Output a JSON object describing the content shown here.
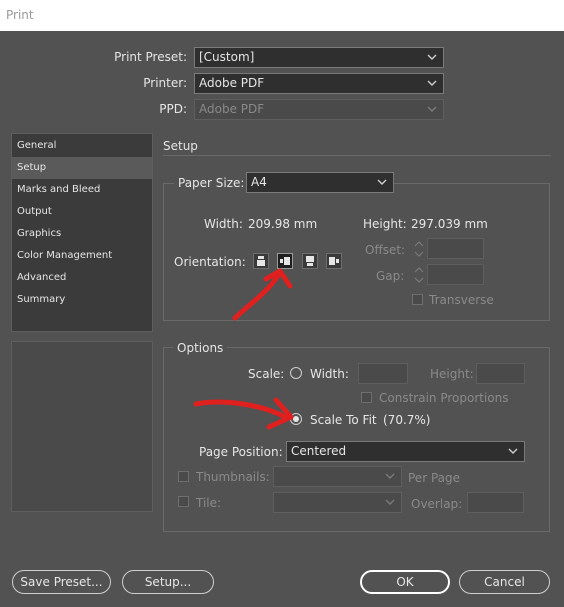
{
  "window": {
    "title": "Print"
  },
  "top": {
    "preset_label": "Print Preset:",
    "preset_value": "[Custom]",
    "printer_label": "Printer:",
    "printer_value": "Adobe PDF",
    "ppd_label": "PPD:",
    "ppd_value": "Adobe PDF"
  },
  "sidebar": {
    "items": [
      "General",
      "Setup",
      "Marks and Bleed",
      "Output",
      "Graphics",
      "Color Management",
      "Advanced",
      "Summary"
    ],
    "active": "Setup"
  },
  "setup": {
    "heading": "Setup",
    "paper_size_label": "Paper Size:",
    "paper_size_value": "A4",
    "width_label": "Width:",
    "width_value": "209.98 mm",
    "height_label": "Height:",
    "height_value": "297.039 mm",
    "orientation_label": "Orientation:",
    "offset_label": "Offset:",
    "gap_label": "Gap:",
    "transverse_label": "Transverse"
  },
  "options": {
    "heading": "Options",
    "scale_label": "Scale:",
    "width_label": "Width:",
    "height_label": "Height:",
    "constrain_label": "Constrain Proportions",
    "scale_to_fit_label": "Scale To Fit",
    "scale_to_fit_value": "(70.7%)",
    "page_position_label": "Page Position:",
    "page_position_value": "Centered",
    "thumbnails_label": "Thumbnails:",
    "per_page_label": "Per Page",
    "tile_label": "Tile:",
    "overlap_label": "Overlap:"
  },
  "buttons": {
    "save_preset": "Save Preset...",
    "setup": "Setup...",
    "ok": "OK",
    "cancel": "Cancel"
  },
  "colors": {
    "background": "#525252",
    "annotation": "#e0201f"
  }
}
